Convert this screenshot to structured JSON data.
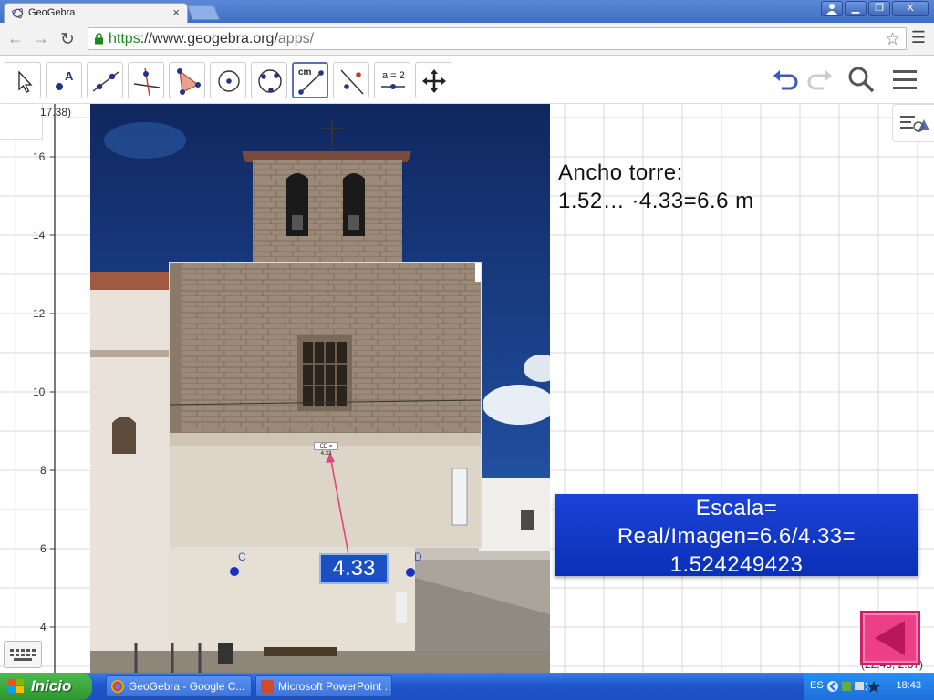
{
  "browser": {
    "tab_title": "GeoGebra",
    "tab_close": "×",
    "url_scheme": "https",
    "url_host": "://www.geogebra.org/",
    "url_path": "apps/",
    "window_buttons": [
      "▁",
      "❐",
      "X"
    ]
  },
  "toolbar": {
    "tools": [
      "move",
      "point",
      "line",
      "perpendicular-line",
      "polygon",
      "circle-center-point",
      "circle-3-points",
      "distance",
      "reflect",
      "slider",
      "move-graphics-view"
    ],
    "active_tool": "distance",
    "tool_texts": {
      "distance": "cm",
      "slider": "a = 2"
    }
  },
  "graphics": {
    "coord_top": "17.38)",
    "coord_bottom": "(22.43, 2.87)",
    "y_axis_labels": [
      "16",
      "14",
      "12",
      "10",
      "8",
      "6",
      "4"
    ],
    "annotation_line1": "Ancho torre:",
    "annotation_line2": "1.52… ·4.33=6.6 m",
    "scale_line1": "Escala=",
    "scale_line2": "Real/Imagen=6.6/4.33=",
    "scale_line3": "1.524249423",
    "measure_value": "4.33",
    "measure_small_label": "CD = 4.33",
    "point_c": "C",
    "point_d": "D",
    "colors": {
      "scale_box": "#1b43d6",
      "back_button": "#ec3f85",
      "vector": "#e0457d"
    }
  },
  "taskbar": {
    "start_label": "Inicio",
    "tasks": [
      "GeoGebra - Google C...",
      "Microsoft PowerPoint ..."
    ],
    "language": "ES",
    "clock": "18:43"
  }
}
